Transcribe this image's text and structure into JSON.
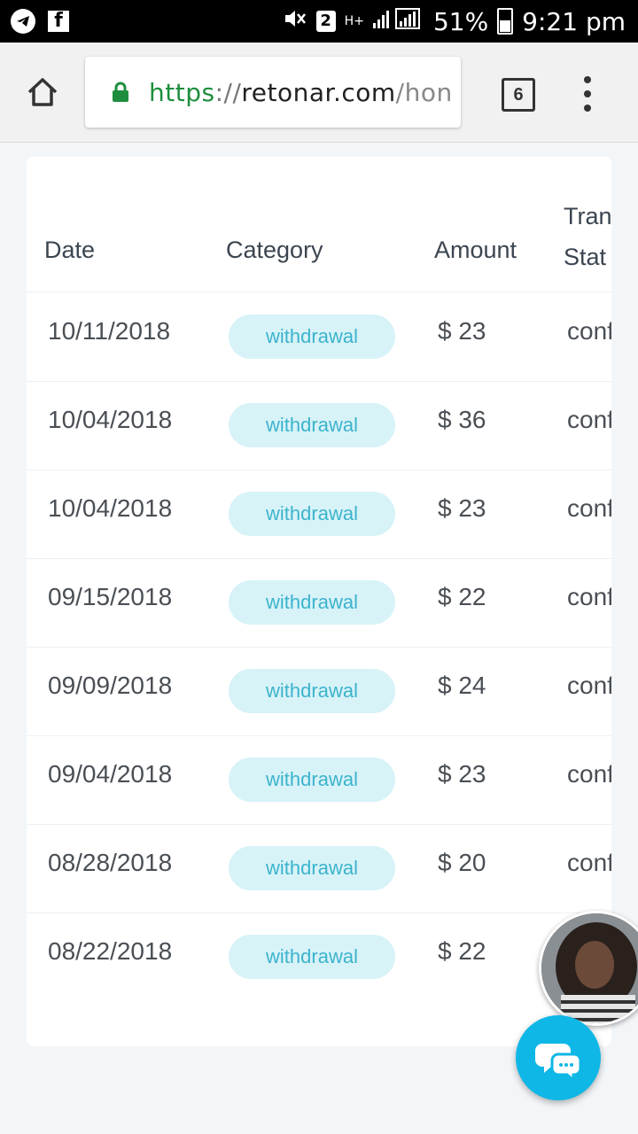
{
  "status_bar": {
    "sim_badge": "2",
    "network_type": "H+",
    "battery_percent": "51%",
    "time": "9:21 pm",
    "left_icons": [
      "telegram-icon",
      "facebook-icon"
    ]
  },
  "browser": {
    "url_scheme": "https",
    "url_separator": "://",
    "url_domain": "retonar.com",
    "url_path": "/hon",
    "tab_count": "6"
  },
  "table": {
    "headers": {
      "date": "Date",
      "category": "Category",
      "amount": "Amount",
      "status": "Tran\nStat"
    },
    "rows": [
      {
        "date": "10/11/2018",
        "category": "withdrawal",
        "amount": "$ 23",
        "status": "conf"
      },
      {
        "date": "10/04/2018",
        "category": "withdrawal",
        "amount": "$ 36",
        "status": "conf"
      },
      {
        "date": "10/04/2018",
        "category": "withdrawal",
        "amount": "$ 23",
        "status": "conf"
      },
      {
        "date": "09/15/2018",
        "category": "withdrawal",
        "amount": "$ 22",
        "status": "conf"
      },
      {
        "date": "09/09/2018",
        "category": "withdrawal",
        "amount": "$ 24",
        "status": "conf"
      },
      {
        "date": "09/04/2018",
        "category": "withdrawal",
        "amount": "$ 23",
        "status": "conf"
      },
      {
        "date": "08/28/2018",
        "category": "withdrawal",
        "amount": "$ 20",
        "status": "conf"
      },
      {
        "date": "08/22/2018",
        "category": "withdrawal",
        "amount": "$ 22",
        "status": ""
      }
    ]
  },
  "colors": {
    "pill_bg": "#d7f3f8",
    "pill_text": "#3cb3cc",
    "chat_button": "#0fb7e6",
    "url_secure": "#1e8e3e"
  }
}
